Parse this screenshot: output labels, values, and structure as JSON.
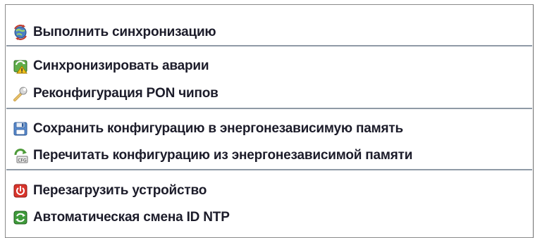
{
  "menu": {
    "items": [
      {
        "label": "Выполнить синхронизацию",
        "icon": "sync-globe-icon"
      },
      {
        "label": "Синхронизировать аварии",
        "icon": "alarm-sync-icon"
      },
      {
        "label": "Реконфигурация PON чипов",
        "icon": "wrench-icon"
      },
      {
        "label": "Сохранить конфигурацию в энергонезависимую память",
        "icon": "floppy-disk-icon"
      },
      {
        "label": "Перечитать конфигурацию из энергонезависимой памяти",
        "icon": "reload-config-icon"
      },
      {
        "label": "Перезагрузить устройство",
        "icon": "power-icon"
      },
      {
        "label": "Автоматическая смена ID NTP",
        "icon": "refresh-arrows-icon"
      }
    ]
  }
}
